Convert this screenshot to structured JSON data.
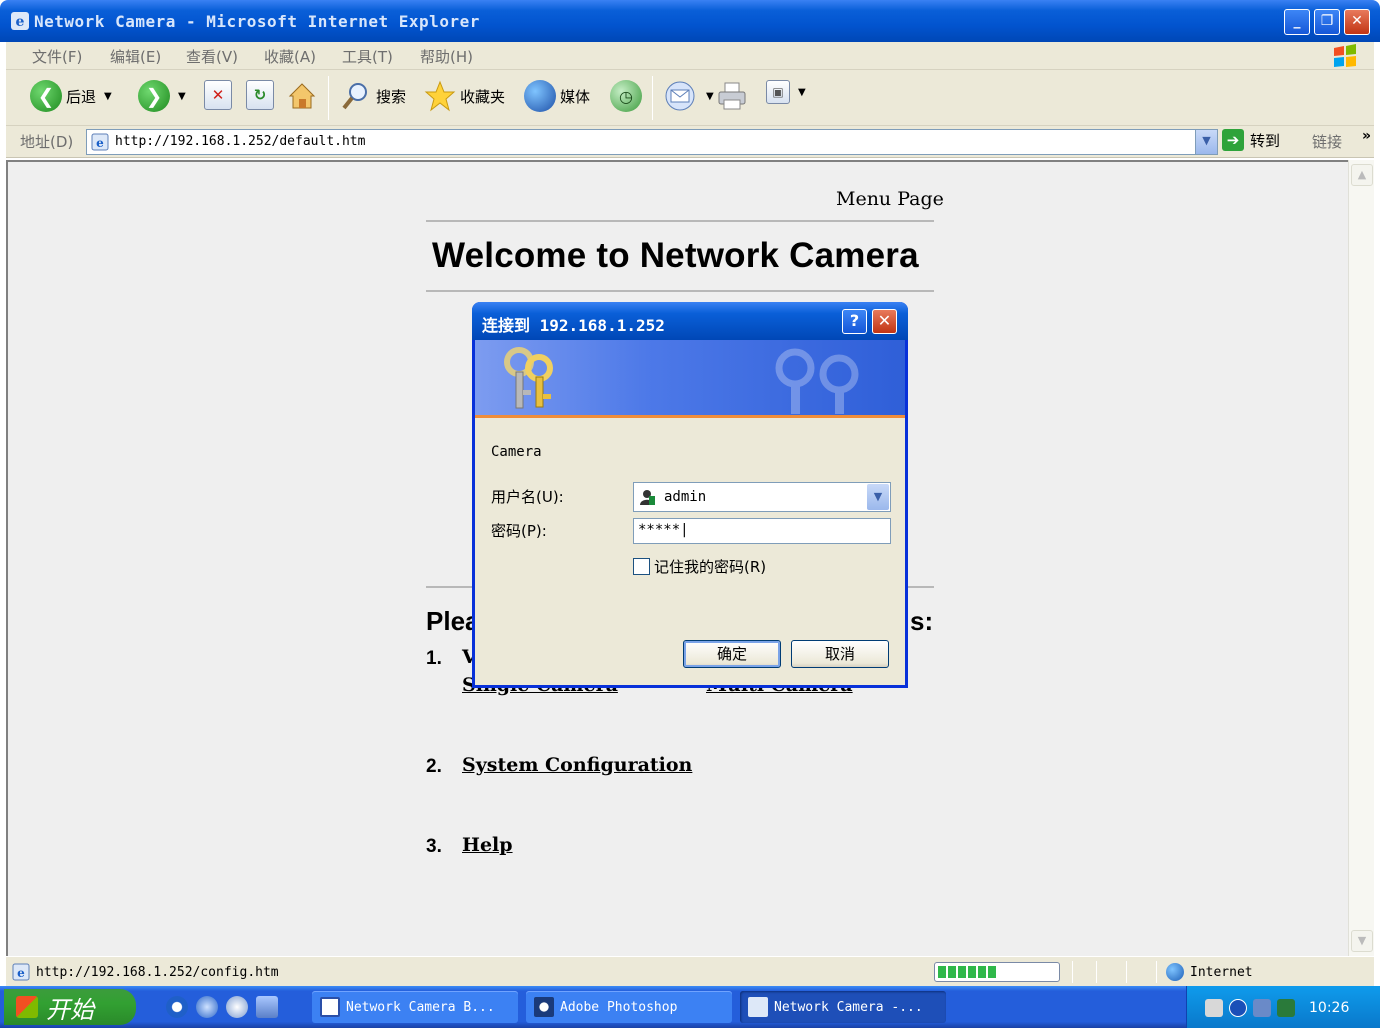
{
  "window": {
    "title": "Network Camera - Microsoft Internet Explorer",
    "min_btn": "_",
    "max_btn": "❐",
    "close_btn": "✕"
  },
  "menubar": {
    "items": [
      "文件(F)",
      "编辑(E)",
      "查看(V)",
      "收藏(A)",
      "工具(T)",
      "帮助(H)"
    ]
  },
  "toolbar": {
    "back_label": "后退",
    "search_label": "搜索",
    "favorites_label": "收藏夹",
    "media_label": "媒体"
  },
  "addressbar": {
    "label": "地址(D)",
    "url": "http://192.168.1.252/default.htm",
    "go_label": "转到",
    "links_label": "链接",
    "chevron": "»"
  },
  "page": {
    "menu_page": "Menu Page",
    "welcome": "Welcome to Network Camera",
    "please_partial": "Plea",
    "please_end": "s:",
    "item1_num": "1.",
    "item1_partial": "V",
    "item1_link_a": "Single Camera",
    "item1_link_b": "Multi Camera",
    "item2_num": "2.",
    "item2_link": "System Configuration",
    "item3_num": "3.",
    "item3_link": "Help"
  },
  "dialog": {
    "title": "连接到 192.168.1.252",
    "help_btn": "?",
    "close_btn": "✕",
    "realm": "Camera",
    "username_label": "用户名(U):",
    "username_value": "admin",
    "password_label": "密码(P):",
    "password_value": "*****|",
    "remember_label": "记住我的密码(R)",
    "remember_checked": false,
    "ok_label": "确定",
    "cancel_label": "取消"
  },
  "statusbar": {
    "url": "http://192.168.1.252/config.htm",
    "zone": "Internet",
    "progress_fraction": 0.5
  },
  "taskbar": {
    "start_label": "开始",
    "tasks": [
      "Network Camera B...",
      "Adobe Photoshop",
      "Network Camera -..."
    ],
    "clock": "10:26"
  }
}
